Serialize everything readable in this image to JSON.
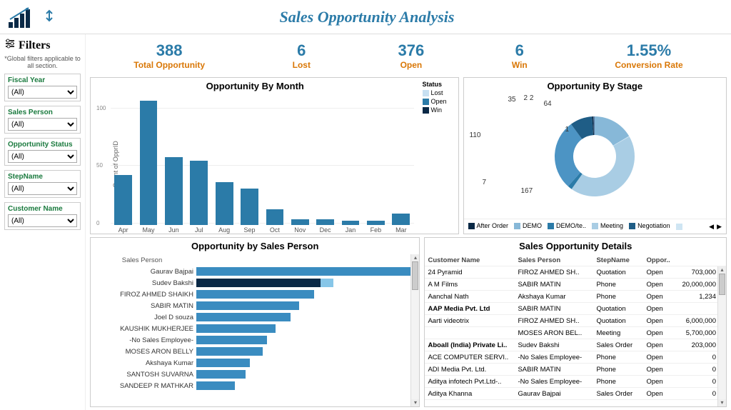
{
  "title": "Sales Opportunity Analysis",
  "filters": {
    "heading": "Filters",
    "note": "*Global filters applicable to all section.",
    "items": [
      {
        "label": "Fiscal Year",
        "value": "(All)"
      },
      {
        "label": "Sales Person",
        "value": "(All)"
      },
      {
        "label": "Opportunity Status",
        "value": "(All)"
      },
      {
        "label": "StepName",
        "value": "(All)"
      },
      {
        "label": "Customer Name",
        "value": "(All)"
      }
    ]
  },
  "kpis": [
    {
      "value": "388",
      "label": "Total Opportunity"
    },
    {
      "value": "6",
      "label": "Lost"
    },
    {
      "value": "376",
      "label": "Open"
    },
    {
      "value": "6",
      "label": "Win"
    },
    {
      "value": "1.55%",
      "label": "Conversion Rate"
    }
  ],
  "chart_data": [
    {
      "type": "bar",
      "title": "Opportunity By Month",
      "ylabel": "Count of OpprID",
      "ylim": [
        0,
        110
      ],
      "categories": [
        "Apr",
        "May",
        "Jun",
        "Jul",
        "Aug",
        "Sep",
        "Oct",
        "Nov",
        "Dec",
        "Jan",
        "Feb",
        "Mar"
      ],
      "values": [
        44,
        110,
        60,
        57,
        38,
        32,
        14,
        5,
        5,
        4,
        4,
        10
      ],
      "status_legend": {
        "title": "Status",
        "items": [
          {
            "name": "Lost",
            "color": "#c7e0f2"
          },
          {
            "name": "Open",
            "color": "#2b7ba8"
          },
          {
            "name": "Win",
            "color": "#0a2946"
          }
        ]
      }
    },
    {
      "type": "pie",
      "title": "Opportunity By Stage",
      "slices": [
        {
          "label": "64",
          "value": 64,
          "color": "#87b8d8"
        },
        {
          "label": "1",
          "value": 1,
          "color": "#cfe5f3"
        },
        {
          "label": "167",
          "value": 167,
          "color": "#a9cde4"
        },
        {
          "label": "7",
          "value": 7,
          "color": "#2b7ba8"
        },
        {
          "label": "110",
          "value": 110,
          "color": "#4c94c4"
        },
        {
          "label": "35",
          "value": 35,
          "color": "#1f5d86"
        },
        {
          "label": "2",
          "value": 2,
          "color": "#0a2946"
        },
        {
          "label": "2",
          "value": 2,
          "color": "#5a7aa0"
        }
      ],
      "legend": [
        "After Order",
        "DEMO",
        "DEMO/te..",
        "Meeting",
        "Negotiation"
      ]
    },
    {
      "type": "bar",
      "orientation": "horizontal",
      "title": "Opportunity by Sales Person",
      "axis_label": "Sales Person",
      "categories": [
        "Gaurav Bajpai",
        "Sudev Bakshi",
        "FIROZ AHMED SHAIKH",
        "SABIR MATIN",
        "Joel D souza",
        "KAUSHIK MUKHERJEE",
        "-No Sales Employee-",
        "MOSES ARON BELLY",
        "Akshaya Kumar",
        "SANTOSH SUVARNA",
        "SANDEEP R MATHKAR"
      ],
      "values": [
        100,
        58,
        55,
        48,
        44,
        37,
        33,
        31,
        25,
        23,
        18
      ],
      "overlay": {
        "index": 1,
        "extra": 6,
        "color": "#87c6e8"
      }
    }
  ],
  "details": {
    "title": "Sales Opportunity Details",
    "columns": [
      "Customer Name",
      "Sales Person",
      "StepName",
      "Oppor.."
    ],
    "rows": [
      {
        "c": "24 Pyramid",
        "p": "FIROZ AHMED SH..",
        "s": "Quotation",
        "o": "Open",
        "v": "703,000"
      },
      {
        "c": "A M Films",
        "p": "SABIR MATIN",
        "s": "Phone",
        "o": "Open",
        "v": "20,000,000"
      },
      {
        "c": "Aanchal Nath",
        "p": "Akshaya Kumar",
        "s": "Phone",
        "o": "Open",
        "v": "1,234"
      },
      {
        "c": "AAP Media Pvt. Ltd",
        "p": "SABIR MATIN",
        "s": "Quotation",
        "o": "Open",
        "v": ""
      },
      {
        "c": "Aarti videotrix",
        "p": "FIROZ AHMED SH..",
        "s": "Quotation",
        "o": "Open",
        "v": "6,000,000"
      },
      {
        "c": "",
        "p": "MOSES ARON BEL..",
        "s": "Meeting",
        "o": "Open",
        "v": "5,700,000"
      },
      {
        "c": "Aboall (India) Private Li..",
        "p": "Sudev Bakshi",
        "s": "Sales Order",
        "o": "Open",
        "v": "203,000"
      },
      {
        "c": "ACE COMPUTER SERVI..",
        "p": "-No Sales Employee-",
        "s": "Phone",
        "o": "Open",
        "v": "0"
      },
      {
        "c": "ADI Media Pvt. Ltd.",
        "p": "SABIR MATIN",
        "s": "Phone",
        "o": "Open",
        "v": "0"
      },
      {
        "c": "Aditya infotech Pvt.Ltd-..",
        "p": "-No Sales Employee-",
        "s": "Phone",
        "o": "Open",
        "v": "0"
      },
      {
        "c": "Aditya Khanna",
        "p": "Gaurav Bajpai",
        "s": "Sales Order",
        "o": "Open",
        "v": "0"
      }
    ]
  }
}
